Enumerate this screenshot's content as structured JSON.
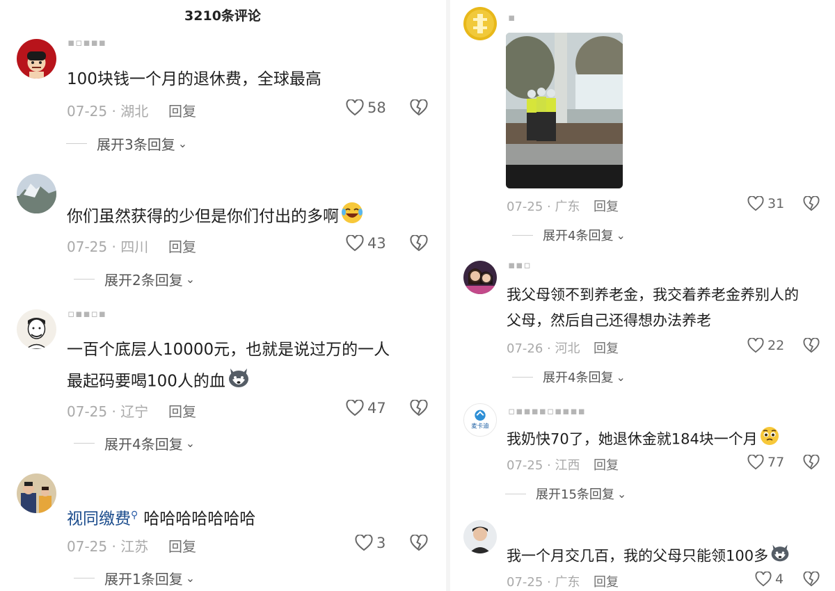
{
  "header": {
    "title": "3210条评论"
  },
  "left_comments": [
    {
      "text": "100块钱一个月的退休费，全球最高",
      "date": "07-25",
      "region": "湖北",
      "reply": "回复",
      "likes": "58",
      "expand": "展开3条回复"
    },
    {
      "text": "你们虽然获得的少但是你们付出的多啊",
      "date": "07-25",
      "region": "四川",
      "reply": "回复",
      "likes": "43",
      "expand": "展开2条回复"
    },
    {
      "text_line1": "一百个底层人10000元，也就是说过万的一人",
      "text_line2": "最起码要喝100人的血",
      "date": "07-25",
      "region": "辽宁",
      "reply": "回复",
      "likes": "47",
      "expand": "展开4条回复"
    },
    {
      "highlight": "视同缴费",
      "text": "哈哈哈哈哈哈哈",
      "date": "07-25",
      "region": "江苏",
      "reply": "回复",
      "likes": "3",
      "expand": "展开1条回复"
    }
  ],
  "right_comments": [
    {
      "date": "07-25",
      "region": "广东",
      "reply": "回复",
      "likes": "31",
      "expand": "展开4条回复"
    },
    {
      "text_line1": "我父母领不到养老金，我交着养老金养别人的",
      "text_line2": "父母，然后自己还得想办法养老",
      "date": "07-26",
      "region": "河北",
      "reply": "回复",
      "likes": "22",
      "expand": "展开4条回复"
    },
    {
      "avatar_text": "麦卡迪",
      "text": "我奶快70了，她退休金就184块一个月",
      "date": "07-25",
      "region": "江西",
      "reply": "回复",
      "likes": "77",
      "expand": "展开15条回复"
    },
    {
      "text": "我一个月交几百，我的父母只能领100多",
      "date": "07-25",
      "region": "广东",
      "reply": "回复",
      "likes": "4"
    }
  ],
  "separator": " · ",
  "colors": {
    "highlight": "#1a4b8c",
    "meta": "#a9a9a9",
    "text": "#1e1e1e"
  },
  "icons": [
    "heart-outline-icon",
    "broken-heart-icon",
    "chevron-down-icon",
    "search-icon",
    "laughing-tears-emoji",
    "husky-emoji",
    "pleading-face-emoji"
  ]
}
